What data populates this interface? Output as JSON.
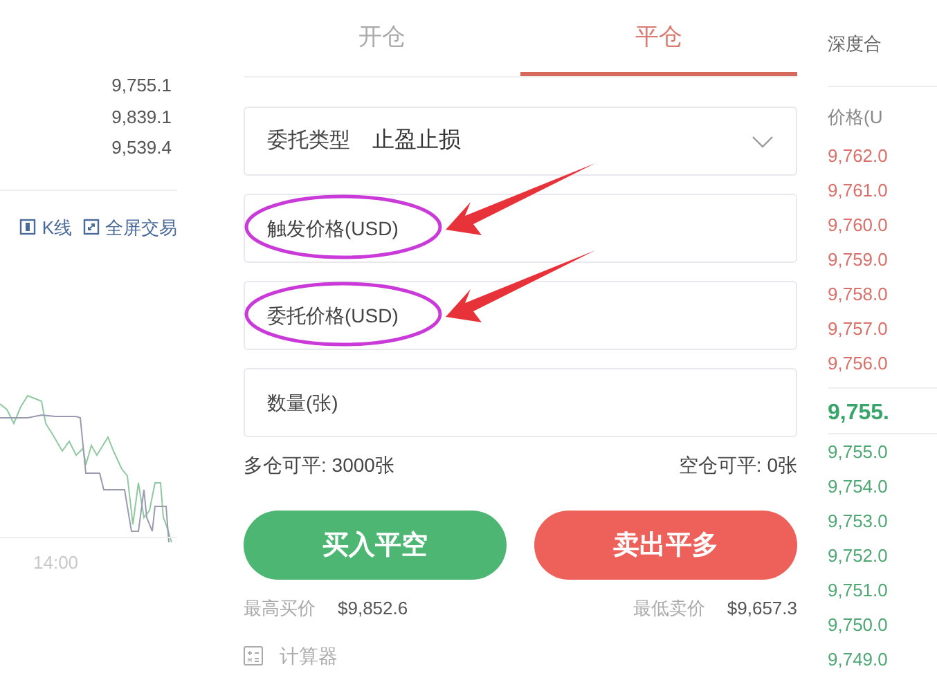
{
  "chart_panel": {
    "stats": [
      "9,755.1",
      "9,839.1",
      "9,539.4"
    ],
    "tools": [
      {
        "label": "K线",
        "kind": "kline"
      },
      {
        "label": "全屏交易",
        "kind": "fullscreen"
      }
    ],
    "time_label": "14:00"
  },
  "tabs": [
    {
      "label": "开仓",
      "selected": false
    },
    {
      "label": "平仓",
      "selected": true
    }
  ],
  "order_type": {
    "label": "委托类型",
    "value": "止盈止损"
  },
  "fields": [
    {
      "placeholder": "触发价格(USD)",
      "annotated": true
    },
    {
      "placeholder": "委托价格(USD)",
      "annotated": true
    },
    {
      "placeholder": "数量(张)",
      "annotated": false
    }
  ],
  "available": {
    "long": "多仓可平: 3000张",
    "short": "空仓可平: 0张"
  },
  "buttons": [
    {
      "label": "买入平空",
      "kind": "buy"
    },
    {
      "label": "卖出平多",
      "kind": "sell"
    }
  ],
  "price_limits": [
    {
      "label": "最高买价",
      "value": "$9,852.6"
    },
    {
      "label": "最低卖价",
      "value": "$9,657.3"
    }
  ],
  "calculator": "计算器",
  "order_book": {
    "title": "深度合",
    "price_header": "价格(U",
    "asks": [
      "9,762.0",
      "9,761.0",
      "9,760.0",
      "9,759.0",
      "9,758.0",
      "9,757.0",
      "9,756.0"
    ],
    "last_price": "9,755.",
    "bids": [
      "9,755.0",
      "9,754.0",
      "9,753.0",
      "9,752.0",
      "9,751.0",
      "9,750.0",
      "9,749.0"
    ]
  }
}
